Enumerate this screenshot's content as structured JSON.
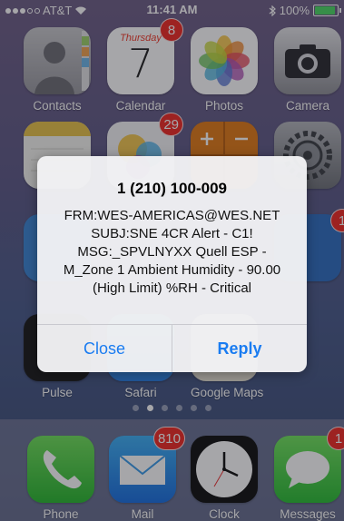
{
  "status_bar": {
    "carrier": "AT&T",
    "time": "11:41 AM",
    "battery": "100%",
    "battery_level": 1.0
  },
  "home_screen": {
    "row1": [
      {
        "label": "Contacts",
        "icon": "contacts-icon"
      },
      {
        "label": "Calendar",
        "icon": "calendar-icon",
        "badge": "8",
        "weekday": "Thursday",
        "date": "7"
      },
      {
        "label": "Photos",
        "icon": "photos-icon"
      },
      {
        "label": "Camera",
        "icon": "camera-icon"
      }
    ],
    "row2": [
      {
        "icon": "notes-icon"
      },
      {
        "icon": "game-center-icon",
        "badge": "29"
      },
      {
        "icon": "calculator-icon"
      },
      {
        "icon": "settings-icon"
      }
    ],
    "row4": [
      {
        "label": "Pulse",
        "icon": "pulse-icon"
      },
      {
        "label": "Safari",
        "icon": "safari-icon"
      },
      {
        "label": "Google Maps",
        "icon": "google-maps-icon"
      }
    ]
  },
  "dock": [
    {
      "label": "Phone",
      "icon": "phone-icon"
    },
    {
      "label": "Mail",
      "icon": "mail-icon",
      "badge": "810"
    },
    {
      "label": "Clock",
      "icon": "clock-icon"
    },
    {
      "label": "Messages",
      "icon": "messages-icon",
      "badge": "1"
    }
  ],
  "alert": {
    "title": "1 (210) 100-009",
    "lines": [
      "FRM:WES-AMERICAS@WES.NET",
      "SUBJ:SNE 4CR Alert - C1!",
      "MSG:_SPVLNYXX Quell ESP -",
      "M_Zone 1 Ambient Humidity - 90.00",
      "(High Limit) %RH - Critical"
    ],
    "close_label": "Close",
    "reply_label": "Reply"
  }
}
